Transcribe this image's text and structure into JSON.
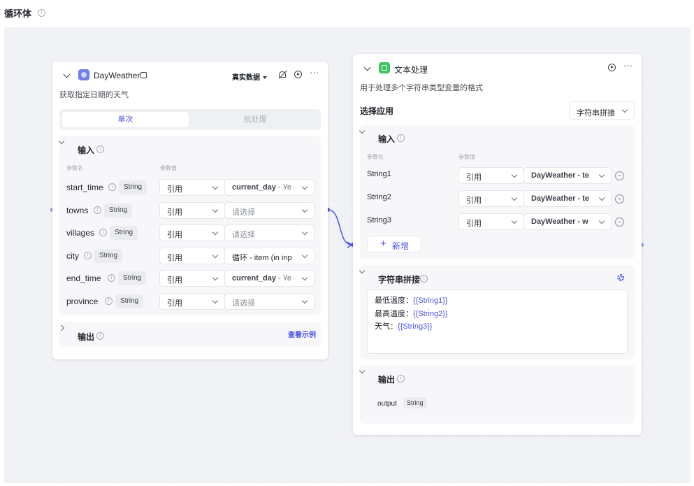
{
  "page": {
    "title": "循环体"
  },
  "node1": {
    "title": "DayWeather",
    "description": "获取指定日期的天气",
    "real_data_label": "真实数据",
    "tabs": {
      "single": "单次",
      "batch": "批处理"
    },
    "input": {
      "title": "输入",
      "col_name": "参数名",
      "col_value": "参数值",
      "rows": [
        {
          "name": "start_time",
          "type": "String",
          "mode": "引用",
          "value": "current_day",
          "value_suffix": " - Ye",
          "style": "bold"
        },
        {
          "name": "towns",
          "type": "String",
          "mode": "引用",
          "value": "请选择",
          "value_suffix": "",
          "style": "placeholder"
        },
        {
          "name": "villages",
          "type": "String",
          "mode": "引用",
          "value": "请选择",
          "value_suffix": "",
          "style": "placeholder"
        },
        {
          "name": "city",
          "type": "String",
          "mode": "引用",
          "value": "循环 - item (in inp",
          "value_suffix": "",
          "style": "normal"
        },
        {
          "name": "end_time",
          "type": "String",
          "mode": "引用",
          "value": "current_day",
          "value_suffix": " - Ye",
          "style": "bold"
        },
        {
          "name": "province",
          "type": "String",
          "mode": "引用",
          "value": "请选择",
          "value_suffix": "",
          "style": "placeholder"
        }
      ]
    },
    "output": {
      "title": "输出",
      "example_link": "查看示例"
    }
  },
  "node2": {
    "title": "文本处理",
    "description": "用于处理多个字符串类型变量的格式",
    "select_app_label": "选择应用",
    "select_app_value": "字符串拼接",
    "input": {
      "title": "输入",
      "col_name": "参数名",
      "col_value": "参数值",
      "rows": [
        {
          "name": "String1",
          "mode": "引用",
          "value": "DayWeather - te"
        },
        {
          "name": "String2",
          "mode": "引用",
          "value": "DayWeather - te"
        },
        {
          "name": "String3",
          "mode": "引用",
          "value": "DayWeather - w"
        }
      ],
      "add_label": "新增"
    },
    "concat": {
      "title": "字符串拼接",
      "lines": [
        {
          "label": "最低温度：",
          "var": "{{String1}}"
        },
        {
          "label": "最高温度：",
          "var": "{{String2}}"
        },
        {
          "label": "天气：",
          "var": "{{String3}}"
        }
      ]
    },
    "output": {
      "title": "输出",
      "name": "output",
      "type": "String"
    }
  },
  "colors": {
    "accent": "#4d53e8",
    "canvas": "#f1f2f5",
    "edge": "#4d53e8"
  }
}
